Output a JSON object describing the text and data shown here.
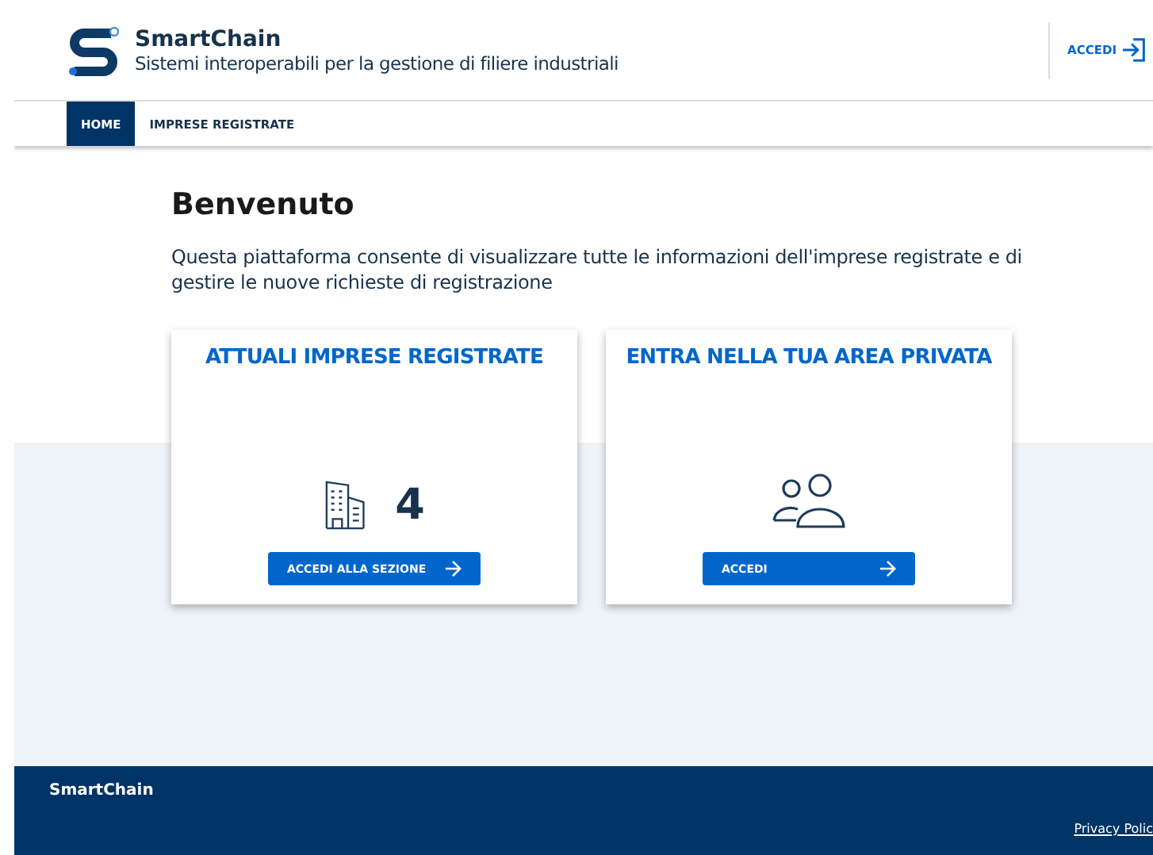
{
  "header": {
    "brand": "SmartChain",
    "subtitle": "Sistemi interoperabili per la gestione di filiere industriali",
    "login": "ACCEDI"
  },
  "nav": [
    {
      "label": "HOME",
      "selected": true
    },
    {
      "label": "IMPRESE REGISTRATE",
      "selected": false
    }
  ],
  "welcome": {
    "title": "Benvenuto",
    "text": "Questa piattaforma consente di visualizzare tutte le informazioni dell'imprese registrate e di gestire le nuove richieste di registrazione"
  },
  "cards": [
    {
      "kind": "count",
      "title": "ATTUALI IMPRESE REGISTRATE",
      "value": "4",
      "button": "ACCEDI ALLA SEZIONE"
    },
    {
      "kind": "users",
      "title": "ENTRA NELLA TUA AREA PRIVATA",
      "button": "ACCEDI"
    }
  ],
  "footer": {
    "brand": "SmartChain",
    "link": "Privacy Polic"
  }
}
